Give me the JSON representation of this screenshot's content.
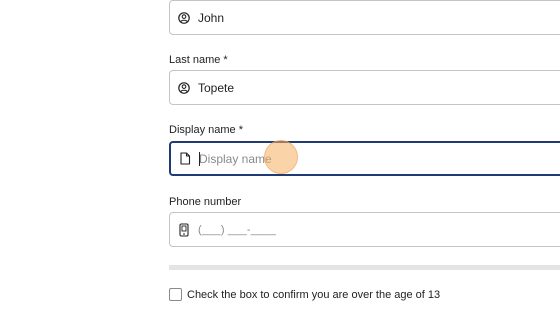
{
  "form": {
    "first_name": {
      "value": "John",
      "icon": "user-circle-icon"
    },
    "last_name": {
      "label": "Last name *",
      "value": "Topete",
      "icon": "user-circle-icon"
    },
    "display_name": {
      "label": "Display name *",
      "placeholder": "Display name",
      "value": "",
      "icon": "document-icon"
    },
    "phone": {
      "label": "Phone number",
      "mask": "(___) ___-____",
      "icon": "phone-icon"
    },
    "age_confirm": {
      "label": "Check the box to confirm you are over the age of 13",
      "checked": false
    }
  },
  "colors": {
    "focus_border": "#1f3b73",
    "input_border": "#c4c4c4",
    "cursor_highlight": "#f6af60"
  }
}
